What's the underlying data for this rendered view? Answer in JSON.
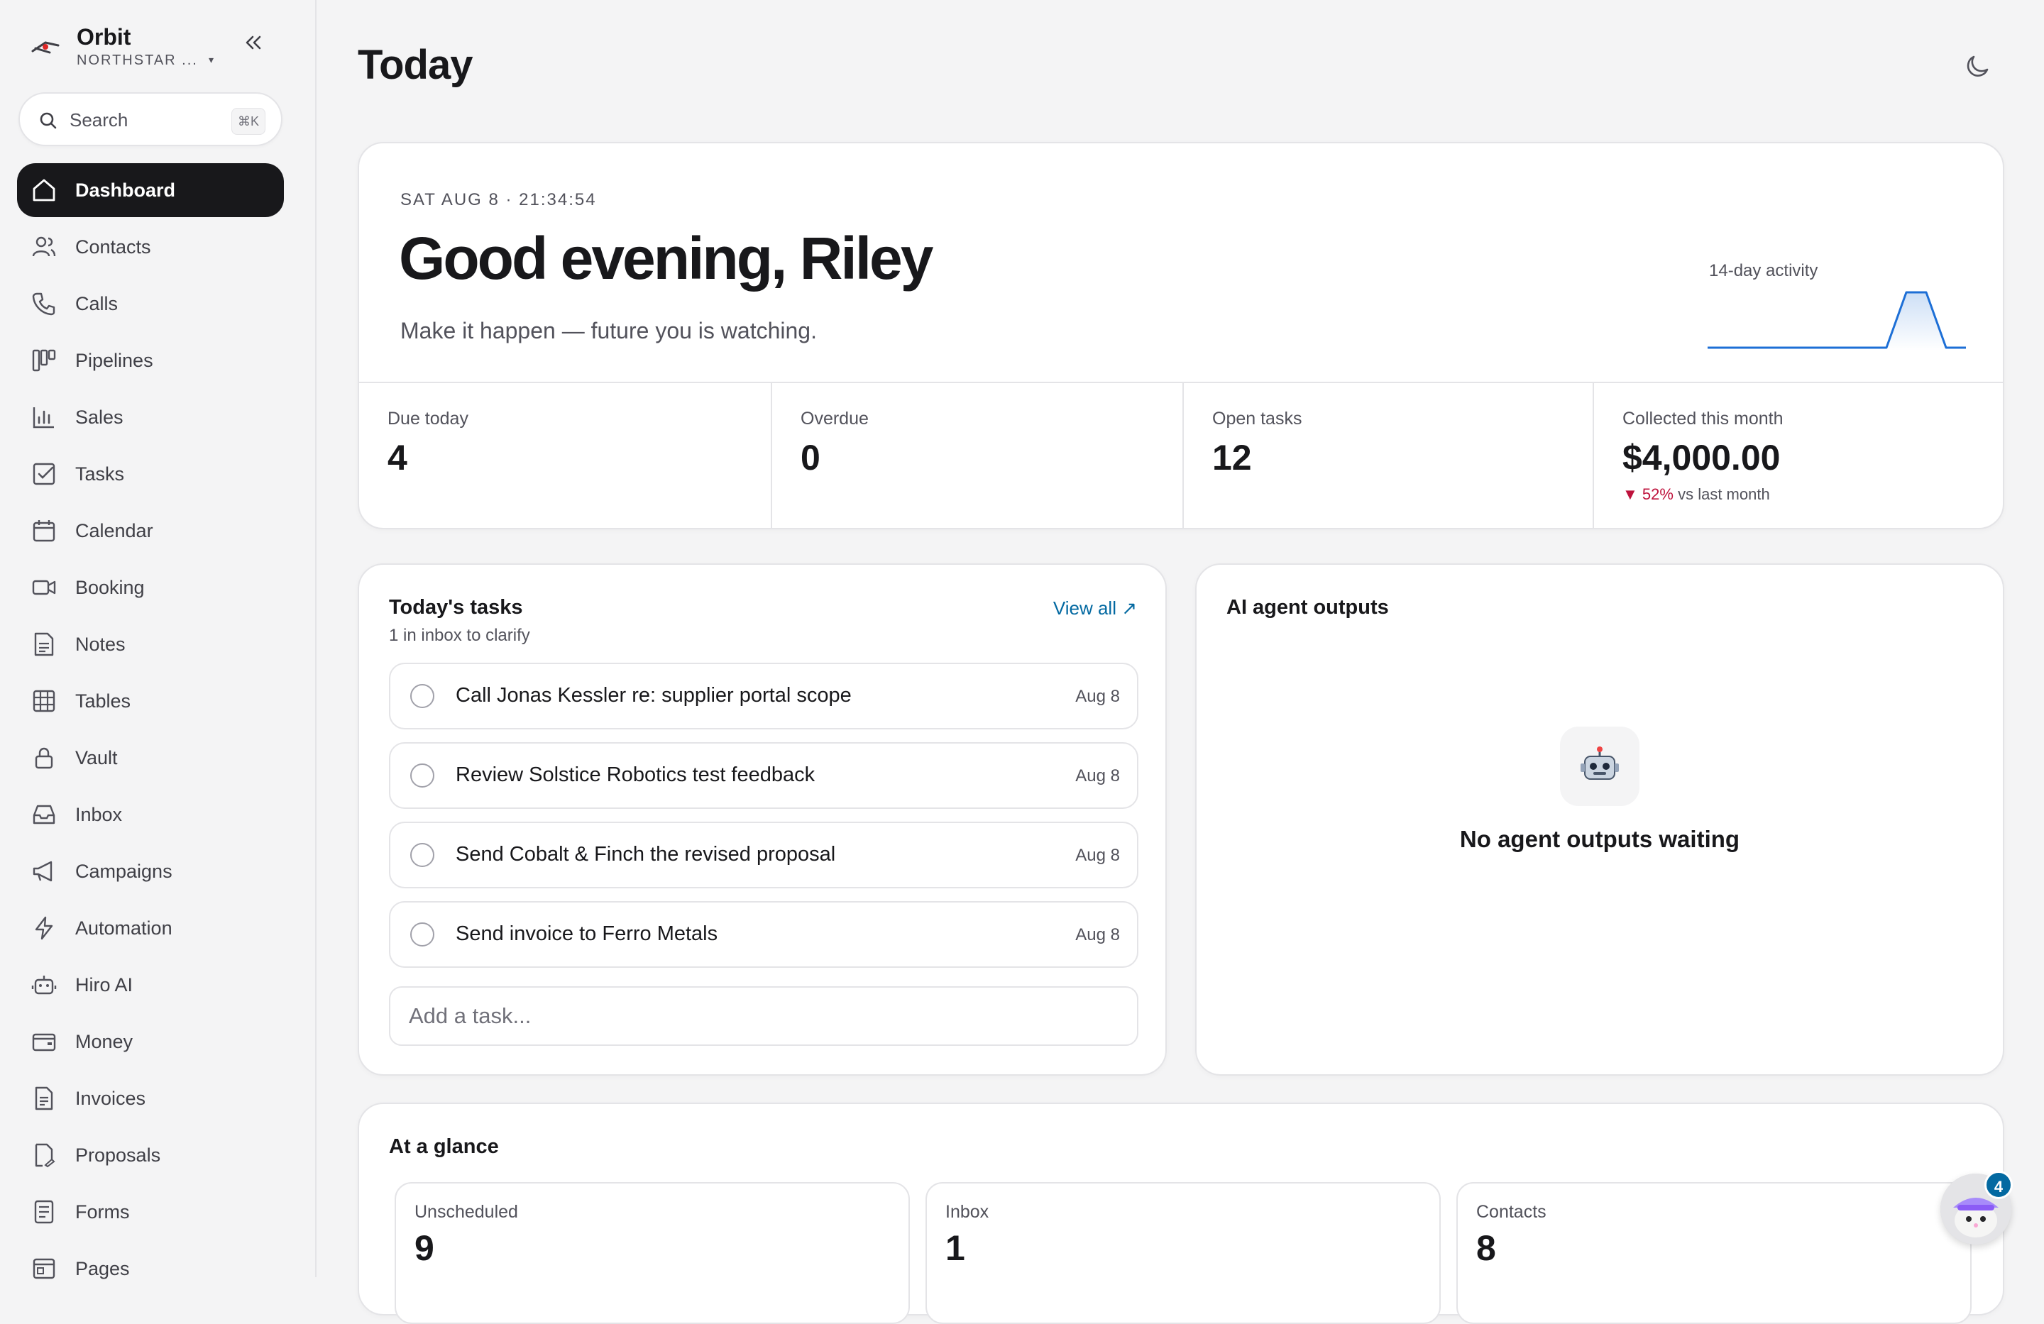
{
  "app": {
    "name": "Orbit",
    "org": "NORTHSTAR ...",
    "org_caret": "▾"
  },
  "search": {
    "label": "Search",
    "shortcut": "⌘K"
  },
  "sidebar": {
    "items": [
      {
        "label": "Dashboard",
        "icon": "home-icon",
        "active": true
      },
      {
        "label": "Contacts",
        "icon": "users-icon"
      },
      {
        "label": "Calls",
        "icon": "phone-icon"
      },
      {
        "label": "Pipelines",
        "icon": "kanban-icon"
      },
      {
        "label": "Sales",
        "icon": "bar-chart-icon"
      },
      {
        "label": "Tasks",
        "icon": "checkbox-icon"
      },
      {
        "label": "Calendar",
        "icon": "calendar-icon"
      },
      {
        "label": "Booking",
        "icon": "video-icon"
      },
      {
        "label": "Notes",
        "icon": "note-icon"
      },
      {
        "label": "Tables",
        "icon": "grid-icon"
      },
      {
        "label": "Vault",
        "icon": "lock-icon"
      },
      {
        "label": "Inbox",
        "icon": "inbox-icon"
      },
      {
        "label": "Campaigns",
        "icon": "megaphone-icon"
      },
      {
        "label": "Automation",
        "icon": "lightning-icon"
      },
      {
        "label": "Hiro AI",
        "icon": "robot-icon"
      },
      {
        "label": "Money",
        "icon": "wallet-icon"
      },
      {
        "label": "Invoices",
        "icon": "invoice-icon"
      },
      {
        "label": "Proposals",
        "icon": "proposal-icon"
      },
      {
        "label": "Forms",
        "icon": "form-icon"
      },
      {
        "label": "Pages",
        "icon": "page-icon"
      }
    ]
  },
  "page": {
    "title": "Today"
  },
  "hero": {
    "datetime": "SAT AUG 8 · 21:34:54",
    "greeting": "Good evening, Riley",
    "tagline": "Make it happen — future you is watching.",
    "activity_title": "14-day activity",
    "activity_values": [
      0,
      0,
      0,
      0,
      0,
      0,
      0,
      0,
      0,
      0,
      1,
      1,
      0,
      0
    ]
  },
  "stats": [
    {
      "label": "Due today",
      "value": "4"
    },
    {
      "label": "Overdue",
      "value": "0"
    },
    {
      "label": "Open tasks",
      "value": "12"
    },
    {
      "label": "Collected this month",
      "value": "$4,000.00",
      "delta_arrow": "▼",
      "delta_value": "52%",
      "delta_text": "vs last month"
    }
  ],
  "tasks": {
    "title": "Today's tasks",
    "subtitle": "1 in inbox to clarify",
    "view_all": "View all ↗",
    "items": [
      {
        "title": "Call Jonas Kessler re: supplier portal scope",
        "date": "Aug 8"
      },
      {
        "title": "Review Solstice Robotics test feedback",
        "date": "Aug 8"
      },
      {
        "title": "Send Cobalt & Finch the revised proposal",
        "date": "Aug 8"
      },
      {
        "title": "Send invoice to Ferro Metals",
        "date": "Aug 8"
      }
    ],
    "add_placeholder": "Add a task..."
  },
  "ai": {
    "title": "AI agent outputs",
    "empty_icon": "🤖",
    "empty_text": "No agent outputs waiting"
  },
  "glance": {
    "title": "At a glance",
    "tiles": [
      {
        "label": "Unscheduled",
        "value": "9"
      },
      {
        "label": "Inbox",
        "value": "1"
      },
      {
        "label": "Contacts",
        "value": "8"
      }
    ]
  },
  "assistant": {
    "badge": "4"
  },
  "colors": {
    "accent": "#0369a1",
    "active_nav": "#18181b",
    "negative": "#be123c",
    "spark_line": "#1d6fd6"
  }
}
